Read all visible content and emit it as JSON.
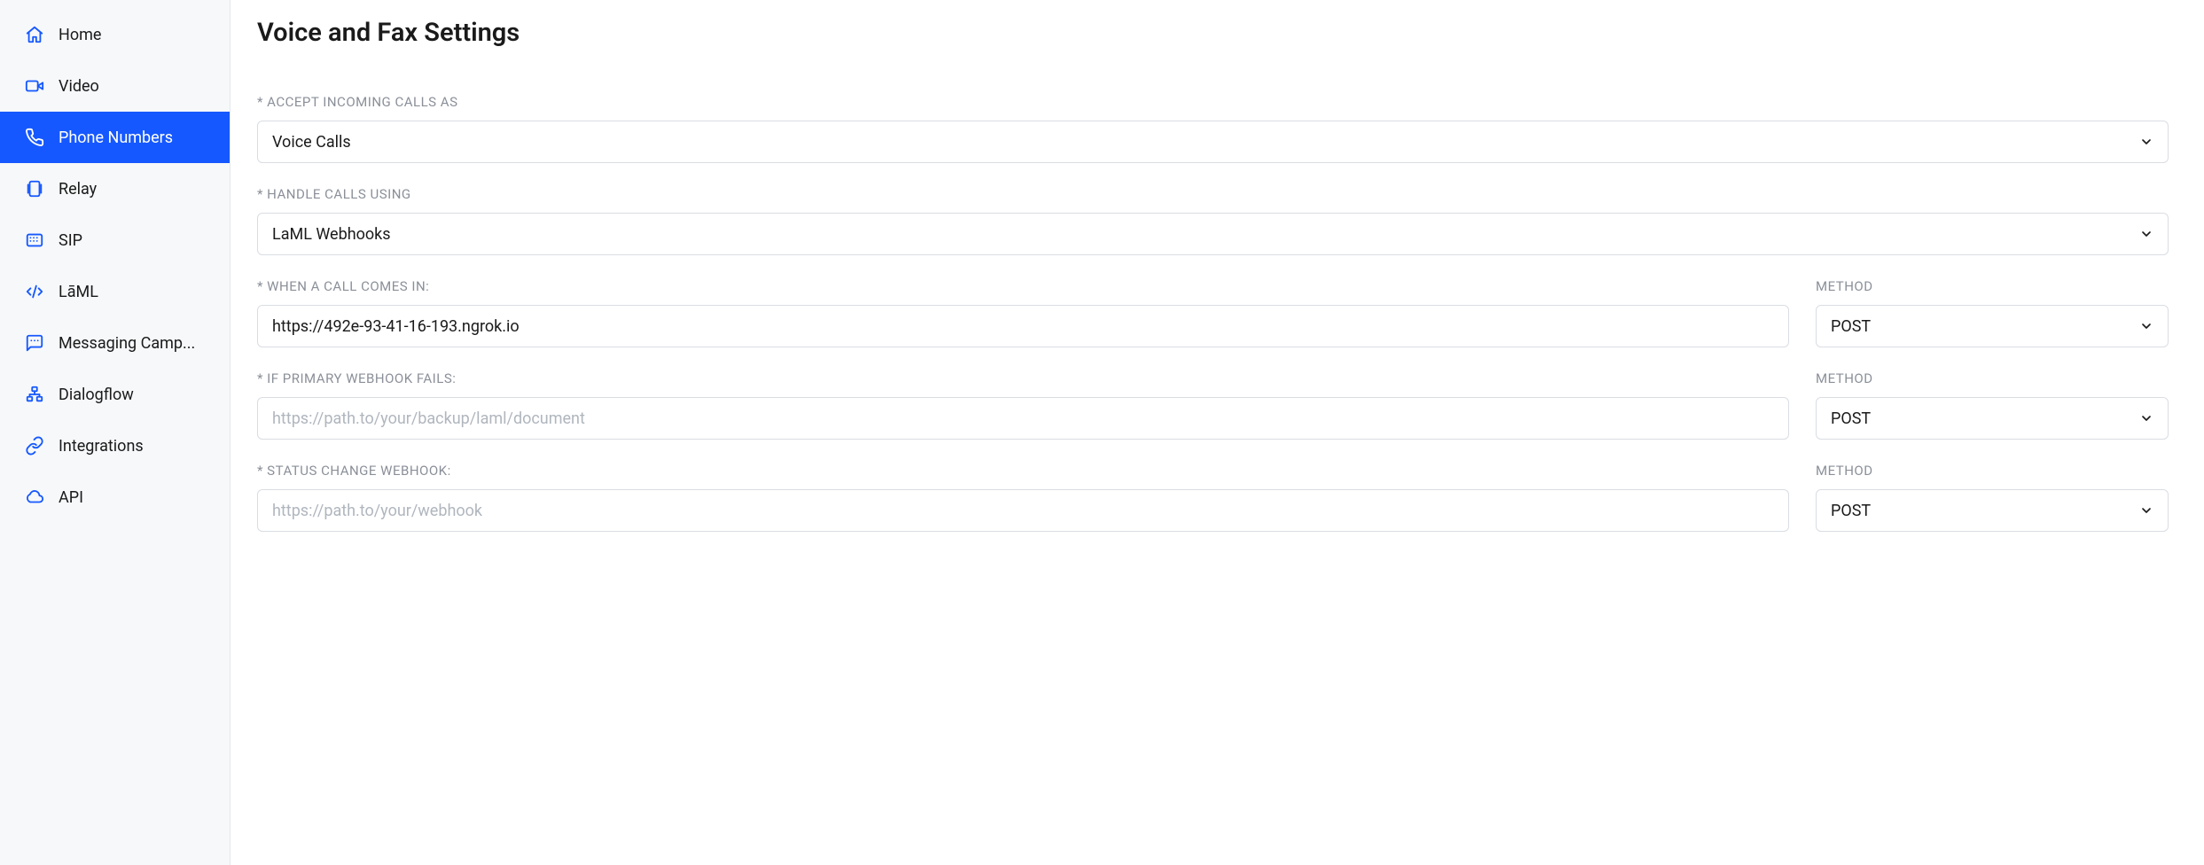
{
  "sidebar": {
    "items": [
      {
        "label": "Home"
      },
      {
        "label": "Video"
      },
      {
        "label": "Phone Numbers"
      },
      {
        "label": "Relay"
      },
      {
        "label": "SIP"
      },
      {
        "label": "LāML"
      },
      {
        "label": "Messaging Camp..."
      },
      {
        "label": "Dialogflow"
      },
      {
        "label": "Integrations"
      },
      {
        "label": "API"
      }
    ],
    "active_index": 2
  },
  "main": {
    "title": "Voice and Fax Settings",
    "fields": {
      "accept_incoming": {
        "label": "* ACCEPT INCOMING CALLS AS",
        "value": "Voice Calls"
      },
      "handle_using": {
        "label": "* HANDLE CALLS USING",
        "value": "LaML Webhooks"
      },
      "call_comes_in": {
        "label": "* WHEN A CALL COMES IN:",
        "value": "https://492e-93-41-16-193.ngrok.io",
        "method_label": "METHOD",
        "method_value": "POST"
      },
      "primary_fails": {
        "label": "* IF PRIMARY WEBHOOK FAILS:",
        "placeholder": "https://path.to/your/backup/laml/document",
        "value": "",
        "method_label": "METHOD",
        "method_value": "POST"
      },
      "status_change": {
        "label": "* STATUS CHANGE WEBHOOK:",
        "placeholder": "https://path.to/your/webhook",
        "value": "",
        "method_label": "METHOD",
        "method_value": "POST"
      }
    }
  },
  "colors": {
    "accent": "#1558ff",
    "sidebar_bg": "#f6f8fa",
    "label": "#8a8f98",
    "border": "#d9dde3"
  }
}
